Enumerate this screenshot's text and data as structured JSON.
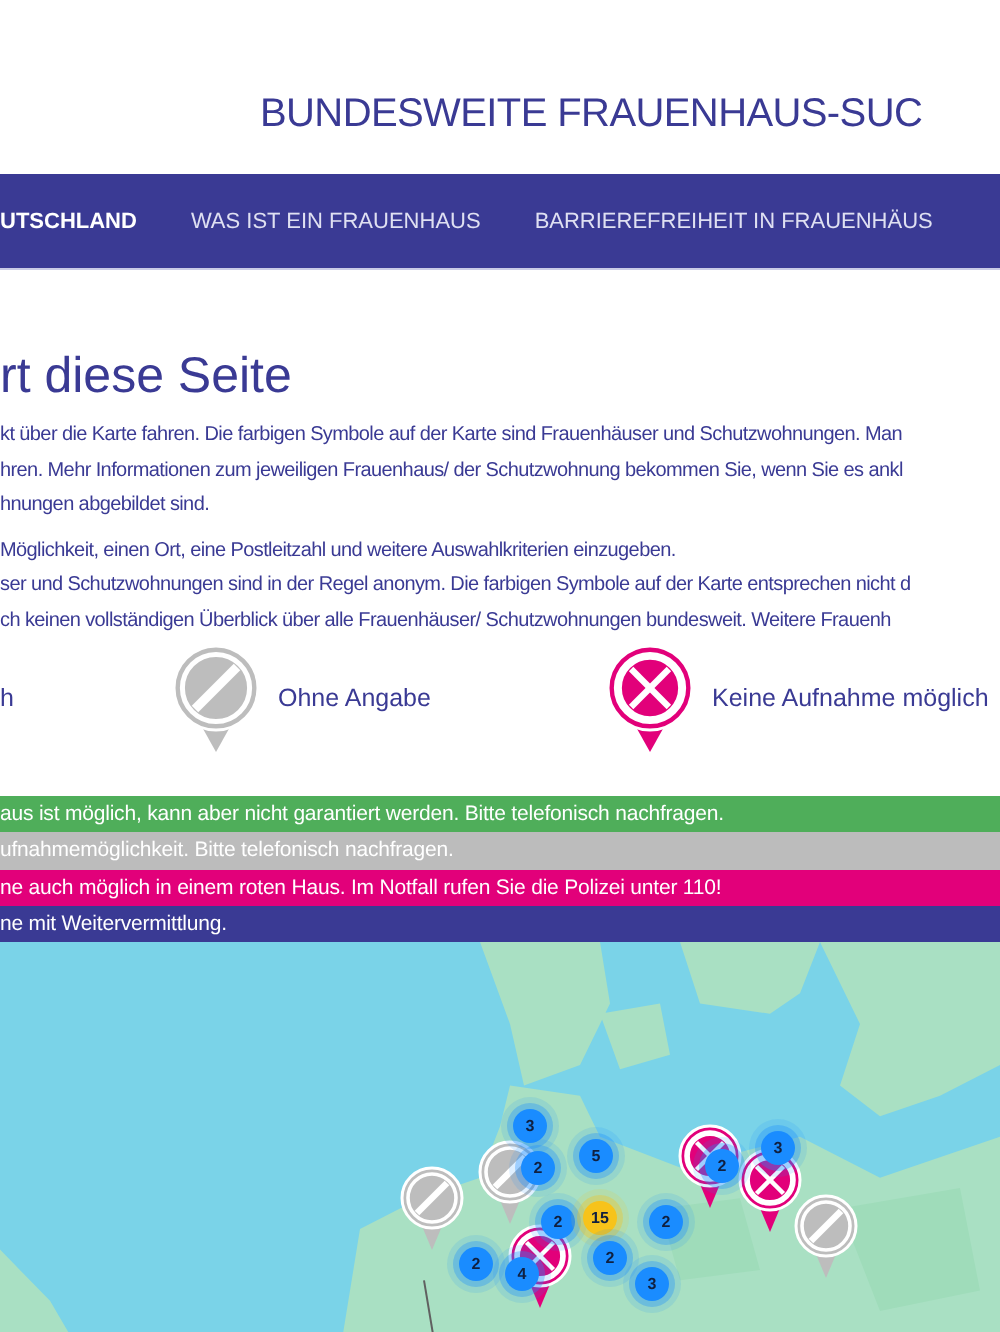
{
  "header": {
    "title": "BUNDESWEITE FRAUENHAUS-SUC"
  },
  "nav": [
    {
      "label": "UTSCHLAND",
      "selected": true
    },
    {
      "label": "WAS IST EIN FRAUENHAUS",
      "selected": false
    },
    {
      "label": "BARRIEREFREIHEIT IN FRAUENHÄUS",
      "selected": false
    }
  ],
  "intro": {
    "heading": "rt diese Seite",
    "paragraph_1": [
      "kt über die Karte fahren. Die farbigen Symbole auf der Karte sind Frauenhäuser und Schutzwohnungen. Man",
      "hren. Mehr Informationen zum jeweiligen Frauenhaus/ der Schutzwohnung bekommen Sie, wenn Sie es ankl",
      "hnungen abgebildet sind."
    ],
    "paragraph_2": [
      "Möglichkeit, einen Ort, eine Postleitzahl und weitere Auswahlkriterien einzugeben.",
      "ser und Schutzwohnungen sind in der Regel anonym. Die farbigen Symbole auf der Karte entsprechen nicht d",
      "ch keinen vollständigen Überblick über alle Frauenhäuser/ Schutzwohnungen bundesweit. Weitere Frauenh"
    ]
  },
  "legend": [
    {
      "kind": "cut",
      "label": "h"
    },
    {
      "kind": "unknown",
      "label": "Ohne Angabe"
    },
    {
      "kind": "full",
      "label": "Keine Aufnahme möglich"
    }
  ],
  "notices": [
    {
      "text": "aus ist möglich, kann aber nicht garantiert werden. Bitte telefonisch nachfragen.",
      "color": "#4fae5a"
    },
    {
      "text": "ufnahmemöglichkeit. Bitte telefonisch nachfragen.",
      "color": "#bcbcbc"
    },
    {
      "text": "ne auch möglich in einem roten Haus. Im Notfall rufen Sie die Polizei unter 110!",
      "color": "#e2007a"
    },
    {
      "text": "ne mit Weitervermittlung.",
      "color": "#3a3a94"
    }
  ],
  "map": {
    "kind": "picture",
    "markers": [
      {
        "kind": "cluster",
        "count": "3",
        "color": "#1a8cff"
      },
      {
        "kind": "unknown"
      },
      {
        "kind": "cluster",
        "count": "2",
        "color": "#1a8cff"
      },
      {
        "kind": "cluster",
        "count": "5",
        "color": "#1a8cff"
      },
      {
        "kind": "full"
      },
      {
        "kind": "cluster",
        "count": "2",
        "color": "#1a8cff"
      },
      {
        "kind": "full"
      },
      {
        "kind": "cluster",
        "count": "3",
        "color": "#1a8cff"
      },
      {
        "kind": "unknown"
      },
      {
        "kind": "cluster",
        "count": "2",
        "color": "#1a8cff"
      },
      {
        "kind": "cluster",
        "count": "15",
        "color": "#f7c31a"
      },
      {
        "kind": "cluster",
        "count": "2",
        "color": "#1a8cff"
      },
      {
        "kind": "unknown"
      },
      {
        "kind": "cluster",
        "count": "2",
        "color": "#1a8cff"
      },
      {
        "kind": "cluster",
        "count": "4",
        "color": "#1a8cff"
      },
      {
        "kind": "full"
      },
      {
        "kind": "cluster",
        "count": "2",
        "color": "#1a8cff"
      },
      {
        "kind": "cluster",
        "count": "3",
        "color": "#1a8cff"
      }
    ]
  }
}
